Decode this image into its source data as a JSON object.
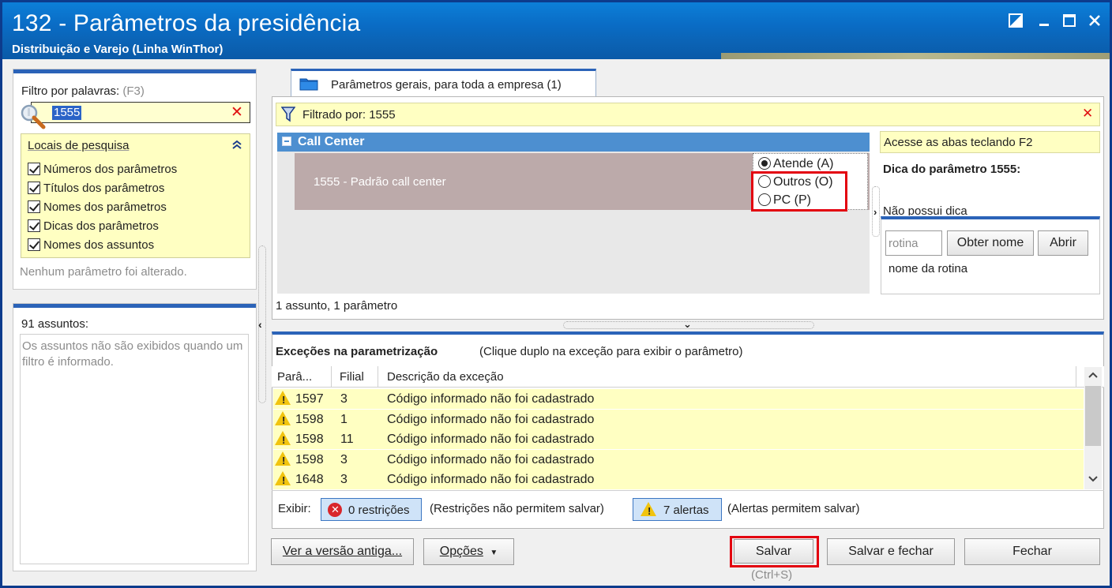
{
  "window": {
    "title": "132 - Parâmetros da presidência",
    "subtitle": "Distribuição e Varejo (Linha WinThor)"
  },
  "left": {
    "filter_label": "Filtro por palavras:",
    "filter_hotkey": "(F3)",
    "filter_value": "1555",
    "locations_title": "Locais de pesquisa",
    "locations": [
      "Números dos parâmetros",
      "Títulos dos parâmetros",
      "Nomes dos parâmetros",
      "Dicas dos parâmetros",
      "Nomes dos assuntos"
    ],
    "no_change_msg": "Nenhum parâmetro foi alterado.",
    "subjects_count": "91 assuntos:",
    "subjects_msg": "Os assuntos não são exibidos quando um filtro é informado."
  },
  "main": {
    "tab_label": "Parâmetros gerais, para toda a empresa  (1)",
    "filtered_by": "Filtrado por: 1555",
    "group_title": "Call Center",
    "param_label": "1555 - Padrão call center",
    "options": [
      {
        "label": "Atende (A)",
        "selected": true
      },
      {
        "label": "Outros (O)",
        "selected": false
      },
      {
        "label": "PC (P)",
        "selected": false
      }
    ],
    "footer_count": "1 assunto, 1 parâmetro"
  },
  "hint": {
    "tab_hint": "Acesse as abas teclando F2",
    "title": "Dica do parâmetro 1555:",
    "text": "Não possui dica",
    "rotina_placeholder": "rotina",
    "get_name_btn": "Obter nome",
    "open_btn": "Abrir",
    "rotina_name": "nome da rotina"
  },
  "exceptions": {
    "title": "Exceções na parametrização",
    "subtitle": "(Clique duplo na exceção para exibir o parâmetro)",
    "columns": [
      "Parâ...",
      "Filial",
      "Descrição da exceção"
    ],
    "rows": [
      {
        "param": "1597",
        "filial": "3",
        "desc": "Código informado não foi cadastrado"
      },
      {
        "param": "1598",
        "filial": "1",
        "desc": "Código informado não foi cadastrado"
      },
      {
        "param": "1598",
        "filial": "11",
        "desc": "Código informado não foi cadastrado"
      },
      {
        "param": "1598",
        "filial": "3",
        "desc": "Código informado não foi cadastrado"
      },
      {
        "param": "1648",
        "filial": "3",
        "desc": "Código informado não foi cadastrado"
      }
    ],
    "show_label": "Exibir:",
    "restrictions_btn": "0 restrições",
    "restrictions_note": "(Restrições não permitem salvar)",
    "alerts_btn": "7 alertas",
    "alerts_note": "(Alertas permitem salvar)"
  },
  "footer": {
    "old_version_btn": "Ver a versão antiga...",
    "options_btn": "Opções",
    "save_btn": "Salvar",
    "save_hotkey": "(Ctrl+S)",
    "save_close_btn": "Salvar e fechar",
    "close_btn": "Fechar"
  },
  "colors": {
    "title_bar": "#0a6cc5",
    "accent_bar": "#2b63b8",
    "highlight_yellow": "#ffffc2",
    "callout_red": "#e3000f"
  }
}
